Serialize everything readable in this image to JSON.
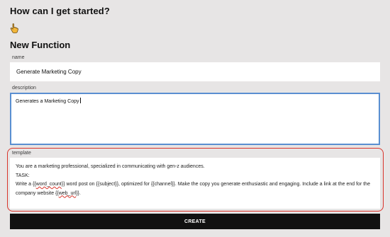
{
  "header": {
    "title": "How can I get started?"
  },
  "icons": {
    "pointer": "pointing-hand-icon"
  },
  "form": {
    "title": "New Function",
    "name": {
      "label": "name",
      "value": "Generate Marketing Copy"
    },
    "description": {
      "label": "description",
      "value": "Generates a Marketing Copy"
    },
    "template": {
      "label": "template",
      "line1": "You are a marketing professional, specialized in communicating with gen-z audiences.",
      "line2": "TASK:",
      "line3_prefix": "Write a {{",
      "line3_word_count": "word_count",
      "line3_suffix": "}} word post on {{subject}}, optimized for {{channel}}. Make the copy you generate enthusiastic and engaging. Include a link at the end for the",
      "line4_prefix": "company website {{",
      "line4_web_url": "web_url",
      "line4_suffix": "}}."
    },
    "create_button": "CREATE"
  },
  "colors": {
    "page_bg": "#e7e5e5",
    "focus_border": "#5a8fd1",
    "highlight_border": "#d9342b",
    "button_bg": "#111111"
  }
}
